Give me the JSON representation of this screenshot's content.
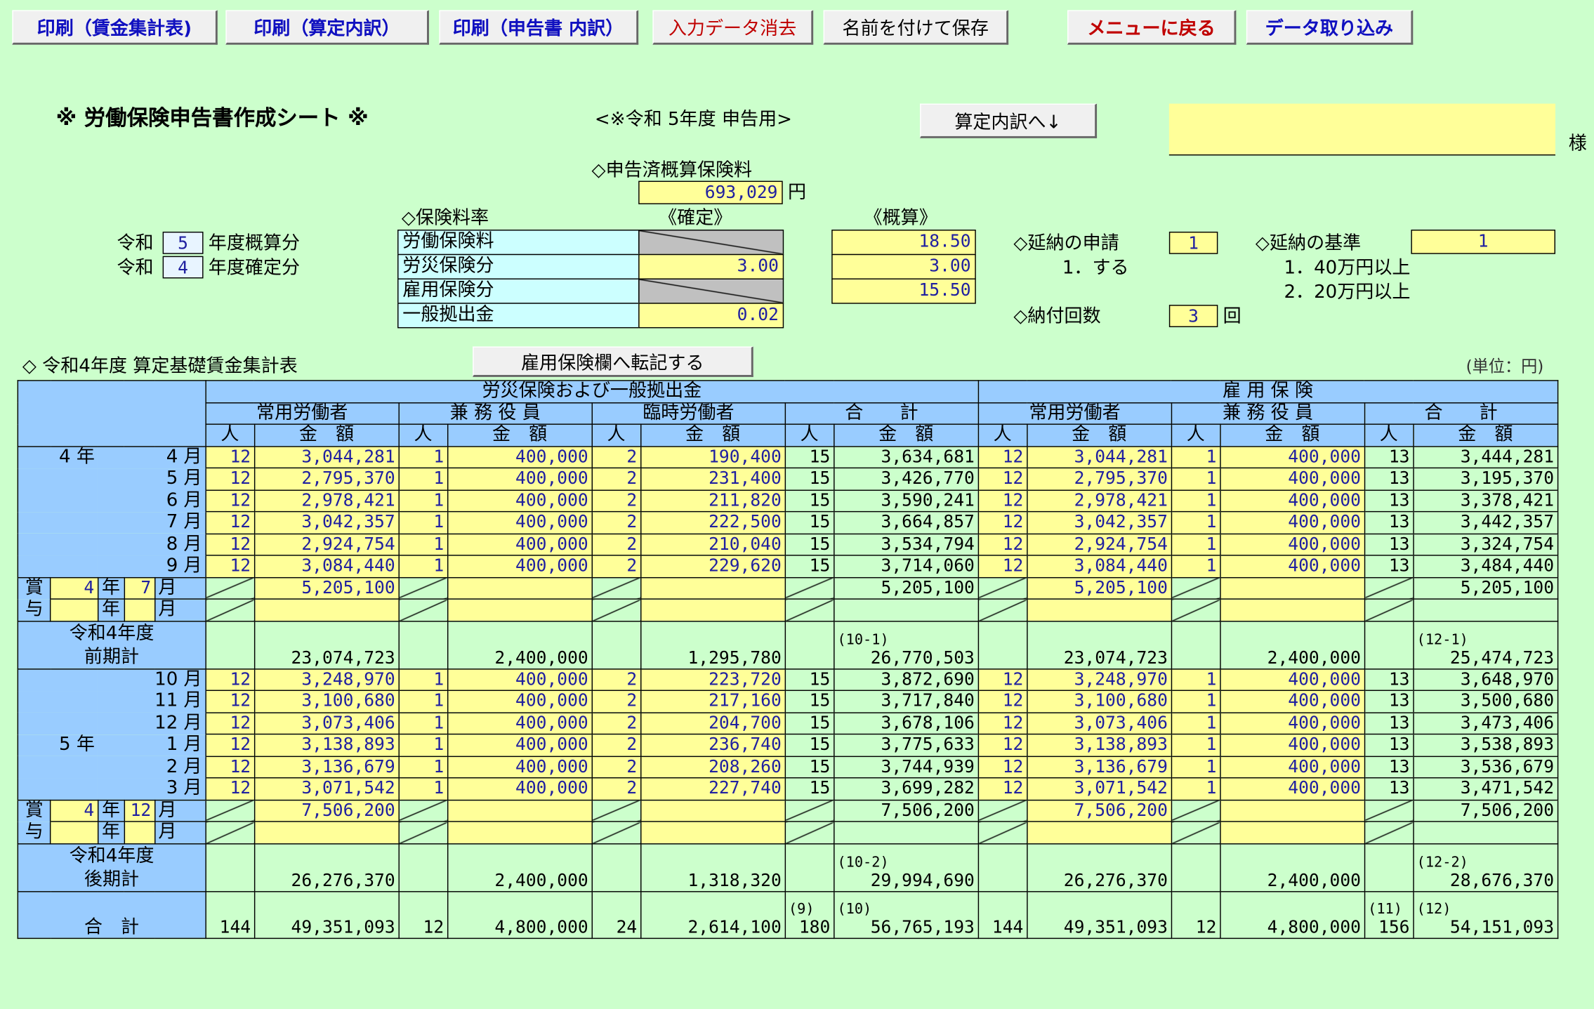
{
  "toolbar": {
    "print_wage": "印刷（賃金集計表)",
    "print_calc": "印刷（算定内訳）",
    "print_report": "印刷（申告書 内訳）",
    "clear": "入力データ消去",
    "save_as": "名前を付けて保存",
    "menu": "メニューに戻る",
    "import": "データ取り込み"
  },
  "colors": {
    "blue_text": "#1010c0",
    "red_text": "#c00000",
    "cell_yellow": "#ffff99",
    "header_blue": "#99ccff",
    "bg_green": "#ccffcc"
  },
  "header": {
    "title": "※ 労働保険申告書作成シート ※",
    "subtitle": "<※令和 5年度 申告用>",
    "goto_calc": "算定内訳へ↓",
    "name_value": "",
    "name_suffix": "様"
  },
  "declared": {
    "label": "◇申告済概算保険料",
    "value": "693,029",
    "unit": "円"
  },
  "rates": {
    "label": "◇保険料率",
    "col_kakutei": "《確定》",
    "col_gaisan": "《概算》",
    "rows": [
      {
        "name": "労働保険料",
        "kakutei": "",
        "gaisan": "18.50"
      },
      {
        "name": "労災保険分",
        "kakutei": "3.00",
        "gaisan": "3.00"
      },
      {
        "name": "雇用保険分",
        "kakutei": "",
        "gaisan": "15.50"
      },
      {
        "name": "一般拠出金",
        "kakutei": "0.02",
        "gaisan": ""
      }
    ]
  },
  "years": {
    "reiwa": "令和",
    "gaisan_year": "5",
    "gaisan_label": "年度概算分",
    "kakutei_year": "4",
    "kakutei_label": "年度確定分"
  },
  "deferral": {
    "apply_label": "◇延納の申請",
    "apply_value": "1",
    "apply_opt": "1．する",
    "basis_label": "◇延納の基準",
    "basis_value": "1",
    "basis_opt1": "1．40万円以上",
    "basis_opt2": "2．20万円以上",
    "count_label": "◇納付回数",
    "count_value": "3",
    "count_unit": "回"
  },
  "section": {
    "title": "◇ 令和4年度 算定基礎賃金集計表",
    "transfer": "雇用保険欄へ転記する",
    "unit": "(単位：円)"
  },
  "table": {
    "grp_rousai": "労災保険および一般拠出金",
    "grp_koyou": "雇 用 保 険",
    "sub_joyo": "常用労働者",
    "sub_kenmu": "兼 務 役 員",
    "sub_rinji": "臨時労働者",
    "sub_total": "合　　計",
    "col_nin": "人",
    "col_kingaku": "金　額",
    "first_half": [
      {
        "y": "4 年",
        "m": "4 月",
        "r": [
          "12",
          "3,044,281",
          "1",
          "400,000",
          "2",
          "190,400",
          "15",
          "3,634,681"
        ],
        "k": [
          "12",
          "3,044,281",
          "1",
          "400,000",
          "13",
          "3,444,281"
        ]
      },
      {
        "y": "",
        "m": "5 月",
        "r": [
          "12",
          "2,795,370",
          "1",
          "400,000",
          "2",
          "231,400",
          "15",
          "3,426,770"
        ],
        "k": [
          "12",
          "2,795,370",
          "1",
          "400,000",
          "13",
          "3,195,370"
        ]
      },
      {
        "y": "",
        "m": "6 月",
        "r": [
          "12",
          "2,978,421",
          "1",
          "400,000",
          "2",
          "211,820",
          "15",
          "3,590,241"
        ],
        "k": [
          "12",
          "2,978,421",
          "1",
          "400,000",
          "13",
          "3,378,421"
        ]
      },
      {
        "y": "",
        "m": "7 月",
        "r": [
          "12",
          "3,042,357",
          "1",
          "400,000",
          "2",
          "222,500",
          "15",
          "3,664,857"
        ],
        "k": [
          "12",
          "3,042,357",
          "1",
          "400,000",
          "13",
          "3,442,357"
        ]
      },
      {
        "y": "",
        "m": "8 月",
        "r": [
          "12",
          "2,924,754",
          "1",
          "400,000",
          "2",
          "210,040",
          "15",
          "3,534,794"
        ],
        "k": [
          "12",
          "2,924,754",
          "1",
          "400,000",
          "13",
          "3,324,754"
        ]
      },
      {
        "y": "",
        "m": "9 月",
        "r": [
          "12",
          "3,084,440",
          "1",
          "400,000",
          "2",
          "229,620",
          "15",
          "3,714,060"
        ],
        "k": [
          "12",
          "3,084,440",
          "1",
          "400,000",
          "13",
          "3,484,440"
        ]
      }
    ],
    "bonus1": {
      "label1": "賞",
      "label2": "与",
      "year": "4",
      "nen": "年",
      "month": "7",
      "tsuki": "月",
      "r_amount": "5,205,100",
      "r_total": "5,205,100",
      "k_amount": "5,205,100",
      "k_total": "5,205,100"
    },
    "sub1": {
      "label1": "令和4年度",
      "label2": "前期計",
      "r": [
        "23,074,723",
        "2,400,000",
        "1,295,780",
        "26,770,503"
      ],
      "ref_r": "(10-1)",
      "k": [
        "23,074,723",
        "2,400,000",
        "25,474,723"
      ],
      "ref_k": "(12-1)"
    },
    "second_half": [
      {
        "y": "",
        "m": "10 月",
        "r": [
          "12",
          "3,248,970",
          "1",
          "400,000",
          "2",
          "223,720",
          "15",
          "3,872,690"
        ],
        "k": [
          "12",
          "3,248,970",
          "1",
          "400,000",
          "13",
          "3,648,970"
        ]
      },
      {
        "y": "",
        "m": "11 月",
        "r": [
          "12",
          "3,100,680",
          "1",
          "400,000",
          "2",
          "217,160",
          "15",
          "3,717,840"
        ],
        "k": [
          "12",
          "3,100,680",
          "1",
          "400,000",
          "13",
          "3,500,680"
        ]
      },
      {
        "y": "",
        "m": "12 月",
        "r": [
          "12",
          "3,073,406",
          "1",
          "400,000",
          "2",
          "204,700",
          "15",
          "3,678,106"
        ],
        "k": [
          "12",
          "3,073,406",
          "1",
          "400,000",
          "13",
          "3,473,406"
        ]
      },
      {
        "y": "5 年",
        "m": "1 月",
        "r": [
          "12",
          "3,138,893",
          "1",
          "400,000",
          "2",
          "236,740",
          "15",
          "3,775,633"
        ],
        "k": [
          "12",
          "3,138,893",
          "1",
          "400,000",
          "13",
          "3,538,893"
        ]
      },
      {
        "y": "",
        "m": "2 月",
        "r": [
          "12",
          "3,136,679",
          "1",
          "400,000",
          "2",
          "208,260",
          "15",
          "3,744,939"
        ],
        "k": [
          "12",
          "3,136,679",
          "1",
          "400,000",
          "13",
          "3,536,679"
        ]
      },
      {
        "y": "",
        "m": "3 月",
        "r": [
          "12",
          "3,071,542",
          "1",
          "400,000",
          "2",
          "227,740",
          "15",
          "3,699,282"
        ],
        "k": [
          "12",
          "3,071,542",
          "1",
          "400,000",
          "13",
          "3,471,542"
        ]
      }
    ],
    "bonus2": {
      "label1": "賞",
      "label2": "与",
      "year": "4",
      "nen": "年",
      "month": "12",
      "tsuki": "月",
      "r_amount": "7,506,200",
      "r_total": "7,506,200",
      "k_amount": "7,506,200",
      "k_total": "7,506,200"
    },
    "sub2": {
      "label1": "令和4年度",
      "label2": "後期計",
      "r": [
        "26,276,370",
        "2,400,000",
        "1,318,320",
        "29,994,690"
      ],
      "ref_r": "(10-2)",
      "k": [
        "26,276,370",
        "2,400,000",
        "28,676,370"
      ],
      "ref_k": "(12-2)"
    },
    "grand": {
      "label": "合　計",
      "r": [
        "144",
        "49,351,093",
        "12",
        "4,800,000",
        "24",
        "2,614,100",
        "180",
        "56,765,193"
      ],
      "ref9": "(9)",
      "ref10": "(10)",
      "k": [
        "144",
        "49,351,093",
        "12",
        "4,800,000",
        "156",
        "54,151,093"
      ],
      "ref11": "(11)",
      "ref12": "(12)"
    }
  }
}
